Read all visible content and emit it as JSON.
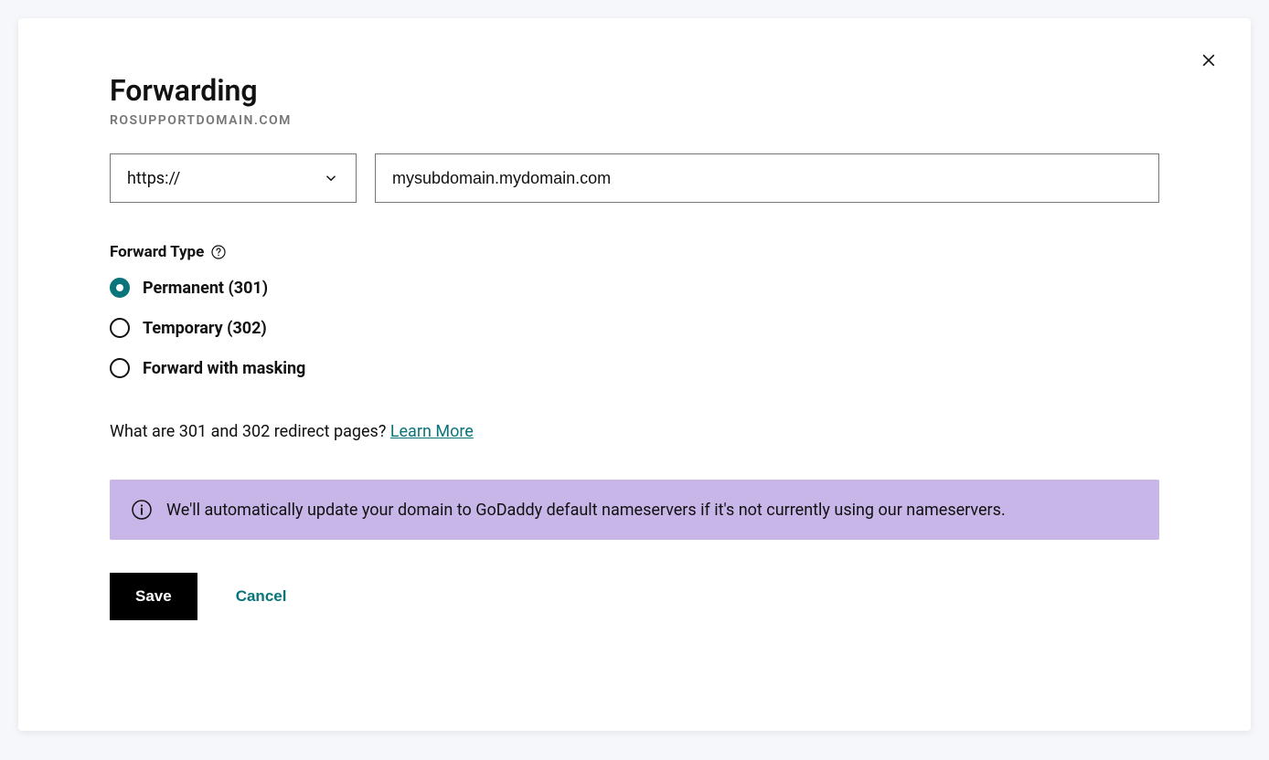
{
  "modal": {
    "title": "Forwarding",
    "subtitle": "ROSUPPORTDOMAIN.COM",
    "protocol": "https://",
    "url_value": "mysubdomain.mydomain.com",
    "forward_type_label": "Forward Type",
    "options": [
      {
        "label": "Permanent (301)",
        "selected": true
      },
      {
        "label": "Temporary (302)",
        "selected": false
      },
      {
        "label": "Forward with masking",
        "selected": false
      }
    ],
    "question_text": "What are 301 and 302 redirect pages? ",
    "learn_more": "Learn More",
    "alert_text": "We'll automatically update your domain to GoDaddy default nameservers if it's not currently using our nameservers.",
    "save_label": "Save",
    "cancel_label": "Cancel"
  }
}
